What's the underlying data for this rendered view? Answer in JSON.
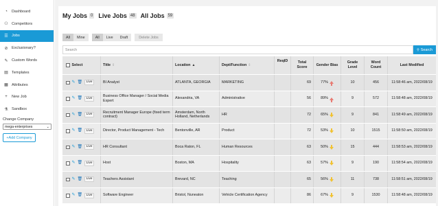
{
  "sidebar": {
    "items": [
      {
        "label": "Dashboard",
        "icon": "dashboard-icon",
        "glyph": "◔"
      },
      {
        "label": "Competitors",
        "icon": "competitors-icon",
        "glyph": "⚇"
      },
      {
        "label": "Jobs",
        "icon": "jobs-list-icon",
        "glyph": "☰"
      },
      {
        "label": "Exclusionary?",
        "icon": "exclusionary-icon",
        "glyph": "⊘"
      },
      {
        "label": "Custom Words",
        "icon": "custom-words-icon",
        "glyph": "✎"
      },
      {
        "label": "Templates",
        "icon": "templates-icon",
        "glyph": "▤"
      },
      {
        "label": "Attributes",
        "icon": "attributes-icon",
        "glyph": "▦"
      },
      {
        "label": "New Job",
        "icon": "plus-icon",
        "glyph": "+"
      },
      {
        "label": "Sandbox",
        "icon": "sandbox-icon",
        "glyph": "⚗"
      }
    ],
    "active_index": 2,
    "change_company_label": "Change Company",
    "company_selected": "mega-enterprises",
    "add_company_label": "+Add Company"
  },
  "header": {
    "tabs": [
      {
        "title": "My Jobs",
        "count": "0"
      },
      {
        "title": "Live Jobs",
        "count": "48"
      },
      {
        "title": "All Jobs",
        "count": "59"
      }
    ]
  },
  "filters": {
    "owner": [
      {
        "label": "All",
        "on": true
      },
      {
        "label": "Mine",
        "on": false
      }
    ],
    "status": [
      {
        "label": "All",
        "on": true
      },
      {
        "label": "Live",
        "on": false
      },
      {
        "label": "Draft",
        "on": false
      }
    ],
    "delete_label": "Delete Jobs"
  },
  "search": {
    "placeholder": "Search",
    "button_label": "Search"
  },
  "table": {
    "headers": {
      "select": "Select",
      "title": "Title",
      "location": "Location",
      "dept": "Dept/Function",
      "req_id": "ReqID",
      "total_score": "Total Score",
      "gender_bias": "Gender Bias",
      "grade_level": "Grade Level",
      "word_count": "Word Count",
      "last_modified": "Last Modified"
    },
    "rows": [
      {
        "status": "Live",
        "title": "BI Analyst",
        "location": "ATLANTA, GEORGIA",
        "dept": "MARKETING",
        "req_id": "",
        "score": "69",
        "bias": "77%",
        "bias_dir": "up",
        "grade": "10",
        "words": "456",
        "modified": "11:58:46 am, 2022/08/19"
      },
      {
        "status": "Live",
        "title": "Business Office Manager / Social Media Expert",
        "location": "Alexandria, VA",
        "dept": "Administrative",
        "req_id": "",
        "score": "56",
        "bias": "89%",
        "bias_dir": "up",
        "grade": "9",
        "words": "572",
        "modified": "11:58:48 am, 2022/08/19"
      },
      {
        "status": "Live",
        "title": "Recruitment Manager Europe (fixed term contract)",
        "location": "Amsterdam, North Holland, Netherlands",
        "dept": "HR",
        "req_id": "",
        "score": "72",
        "bias": "65%",
        "bias_dir": "down",
        "grade": "9",
        "words": "841",
        "modified": "11:58:49 am, 2022/08/19"
      },
      {
        "status": "Live",
        "title": "Director, Product Management - Tech",
        "location": "Bentonville, AR",
        "dept": "Product",
        "req_id": "",
        "score": "72",
        "bias": "53%",
        "bias_dir": "down",
        "grade": "10",
        "words": "1515",
        "modified": "11:58:50 am, 2022/08/19"
      },
      {
        "status": "Live",
        "title": "HR Consultant",
        "location": "Boca Raton, FL",
        "dept": "Human Resources",
        "req_id": "",
        "score": "63",
        "bias": "50%",
        "bias_dir": "down",
        "grade": "15",
        "words": "444",
        "modified": "11:58:53 am, 2022/08/19"
      },
      {
        "status": "Live",
        "title": "Host",
        "location": "Boston, MA",
        "dept": "Hospitality",
        "req_id": "",
        "score": "63",
        "bias": "57%",
        "bias_dir": "down",
        "grade": "9",
        "words": "190",
        "modified": "11:58:54 am, 2022/08/19"
      },
      {
        "status": "Live",
        "title": "Teachers Assistant",
        "location": "Brevard, NC",
        "dept": "Teaching",
        "req_id": "",
        "score": "65",
        "bias": "56%",
        "bias_dir": "down",
        "grade": "11",
        "words": "738",
        "modified": "11:58:51 am, 2022/08/19"
      },
      {
        "status": "Live",
        "title": "Software Engineer",
        "location": "Bristol, Nuneaton",
        "dept": "Vehicle Certification Agency",
        "req_id": "",
        "score": "86",
        "bias": "67%",
        "bias_dir": "down",
        "grade": "9",
        "words": "1530",
        "modified": "11:58:48 am, 2022/08/19"
      }
    ]
  },
  "colors": {
    "accent": "#1a9ad6",
    "bias_up": "#e87b73",
    "bias_down": "#f1c232"
  },
  "icons": {
    "sort": "sort-icon",
    "sort_asc": "sort-asc-icon",
    "edit": "edit-icon",
    "trash": "trash-icon",
    "search": "search-icon"
  }
}
